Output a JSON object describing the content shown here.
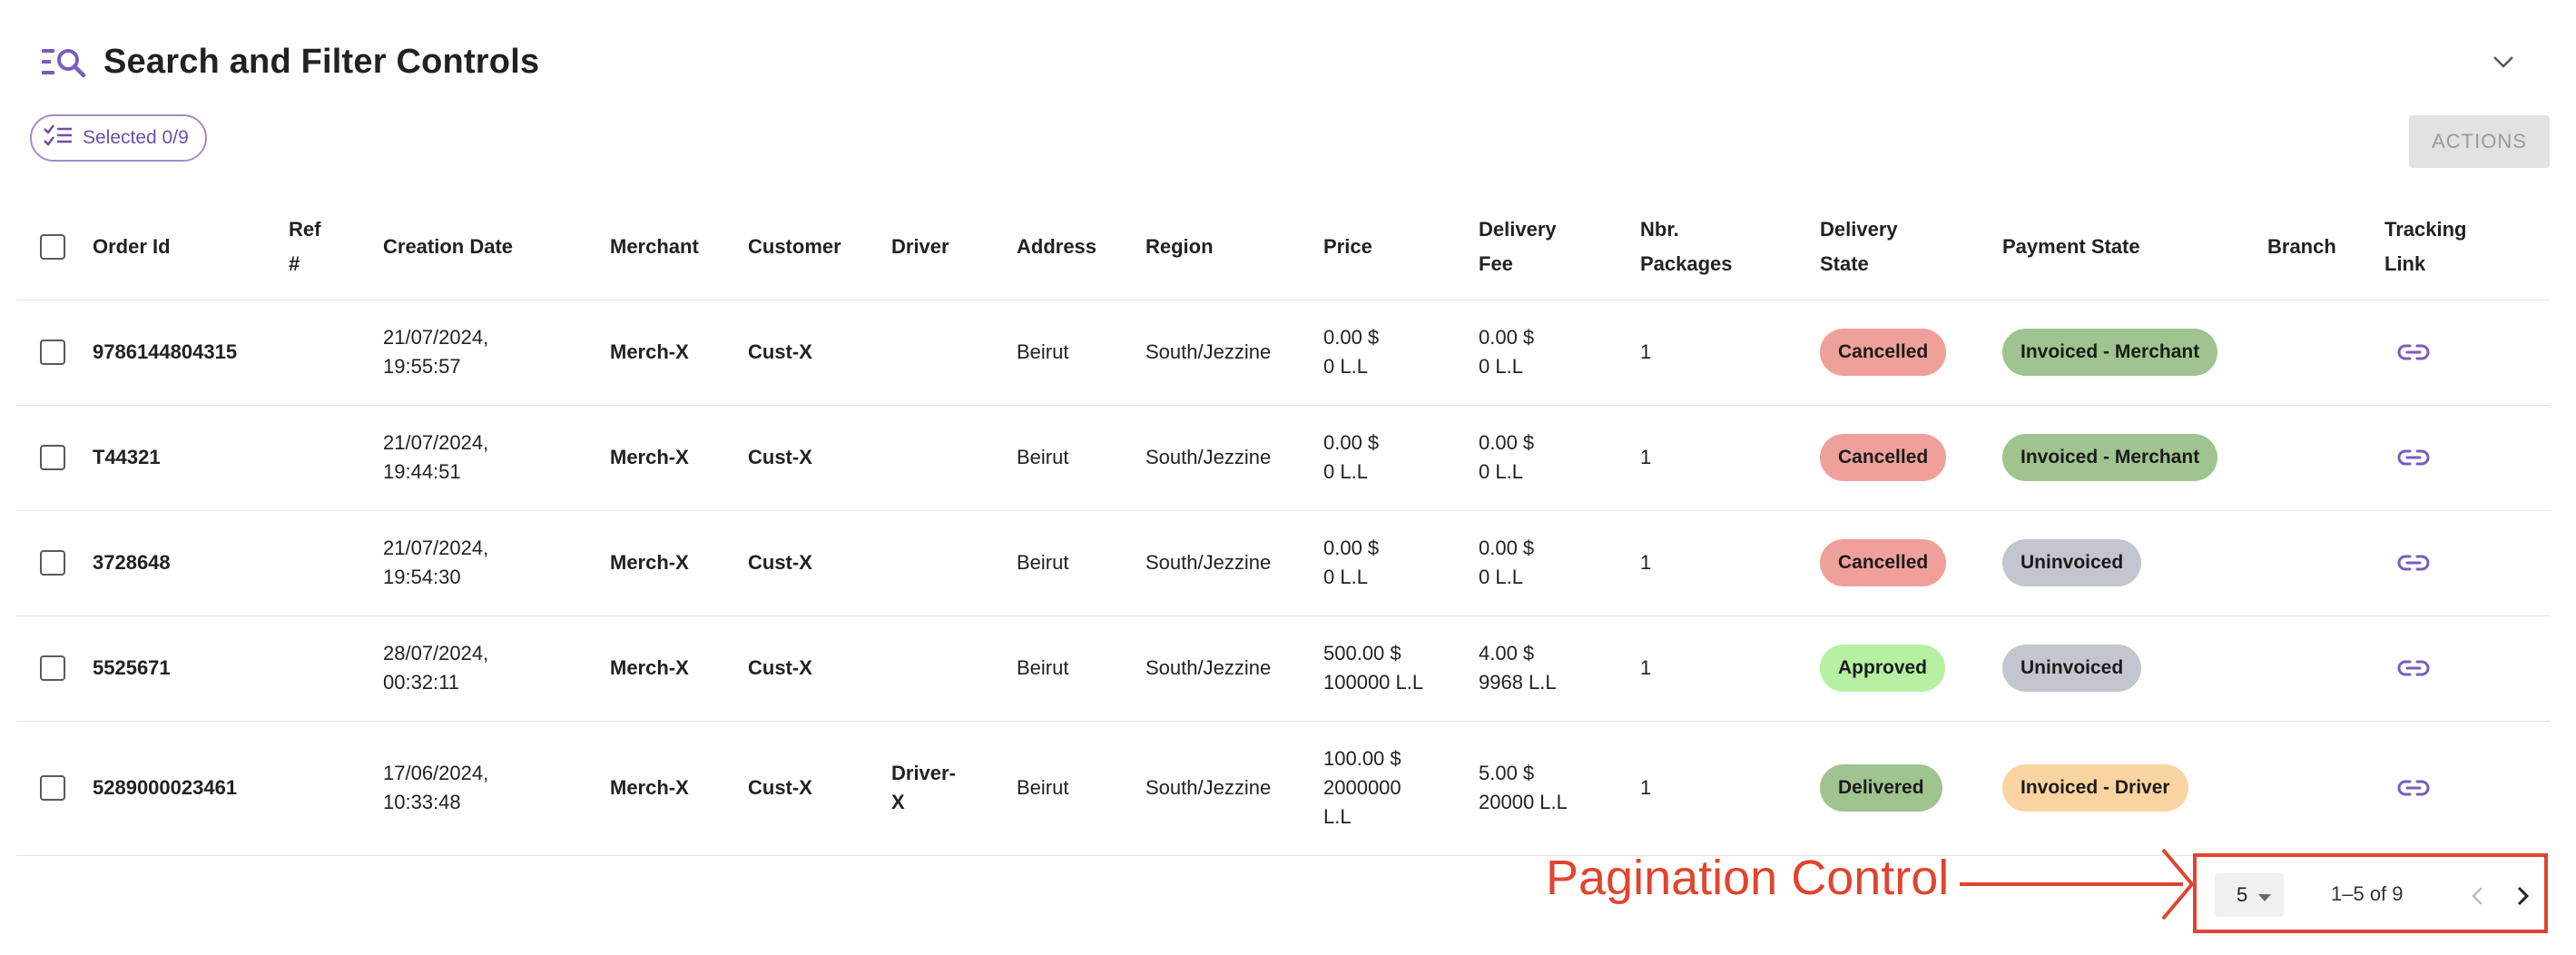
{
  "header": {
    "title": "Search and Filter Controls"
  },
  "toolbar": {
    "selected_label": "Selected 0/9",
    "actions_label": "ACTIONS"
  },
  "table": {
    "columns": {
      "order_id": "Order Id",
      "ref": "Ref #",
      "creation_date": "Creation Date",
      "merchant": "Merchant",
      "customer": "Customer",
      "driver": "Driver",
      "address": "Address",
      "region": "Region",
      "price": "Price",
      "delivery_fee": "Delivery Fee",
      "packages": "Nbr. Packages",
      "delivery_state": "Delivery State",
      "payment_state": "Payment State",
      "branch": "Branch",
      "tracking": "Tracking Link"
    },
    "rows": [
      {
        "order_id": "9786144804315",
        "ref": "",
        "date": "21/07/2024,",
        "time": "19:55:57",
        "merchant": "Merch-X",
        "customer": "Cust-X",
        "driver": "",
        "address": "Beirut",
        "region": "South/Jezzine",
        "price_usd": "0.00 $",
        "price_ll": "0 L.L",
        "fee_usd": "0.00 $",
        "fee_ll": "0 L.L",
        "packages": "1",
        "delivery_state": "Cancelled",
        "delivery_color": "#f0a09a",
        "payment_state": "Invoiced - Merchant",
        "payment_color": "#9fc48f",
        "branch": ""
      },
      {
        "order_id": "T44321",
        "ref": "",
        "date": "21/07/2024,",
        "time": "19:44:51",
        "merchant": "Merch-X",
        "customer": "Cust-X",
        "driver": "",
        "address": "Beirut",
        "region": "South/Jezzine",
        "price_usd": "0.00 $",
        "price_ll": "0 L.L",
        "fee_usd": "0.00 $",
        "fee_ll": "0 L.L",
        "packages": "1",
        "delivery_state": "Cancelled",
        "delivery_color": "#f0a09a",
        "payment_state": "Invoiced - Merchant",
        "payment_color": "#9fc48f",
        "branch": ""
      },
      {
        "order_id": "3728648",
        "ref": "",
        "date": "21/07/2024,",
        "time": "19:54:30",
        "merchant": "Merch-X",
        "customer": "Cust-X",
        "driver": "",
        "address": "Beirut",
        "region": "South/Jezzine",
        "price_usd": "0.00 $",
        "price_ll": "0 L.L",
        "fee_usd": "0.00 $",
        "fee_ll": "0 L.L",
        "packages": "1",
        "delivery_state": "Cancelled",
        "delivery_color": "#f0a09a",
        "payment_state": "Uninvoiced",
        "payment_color": "#c3c6cf",
        "branch": ""
      },
      {
        "order_id": "5525671",
        "ref": "",
        "date": "28/07/2024,",
        "time": "00:32:11",
        "merchant": "Merch-X",
        "customer": "Cust-X",
        "driver": "",
        "address": "Beirut",
        "region": "South/Jezzine",
        "price_usd": "500.00 $",
        "price_ll": "100000 L.L",
        "fee_usd": "4.00 $",
        "fee_ll": "9968 L.L",
        "packages": "1",
        "delivery_state": "Approved",
        "delivery_color": "#b6f0a2",
        "payment_state": "Uninvoiced",
        "payment_color": "#c3c6cf",
        "branch": ""
      },
      {
        "order_id": "5289000023461",
        "ref": "",
        "date": "17/06/2024,",
        "time": "10:33:48",
        "merchant": "Merch-X",
        "customer": "Cust-X",
        "driver": "Driver-X",
        "address": "Beirut",
        "region": "South/Jezzine",
        "price_usd": "100.00 $",
        "price_ll": "2000000 L.L",
        "fee_usd": "5.00 $",
        "fee_ll": "20000 L.L",
        "packages": "1",
        "delivery_state": "Delivered",
        "delivery_color": "#9fc48f",
        "payment_state": "Invoiced - Driver",
        "payment_color": "#fad4a0",
        "branch": ""
      }
    ]
  },
  "pagination": {
    "rows_per_page": "5",
    "range_label": "1–5 of 9"
  },
  "annotation": {
    "label": "Pagination Control",
    "color": "#e0452f"
  },
  "colors": {
    "accent": "#7a5cc0"
  }
}
